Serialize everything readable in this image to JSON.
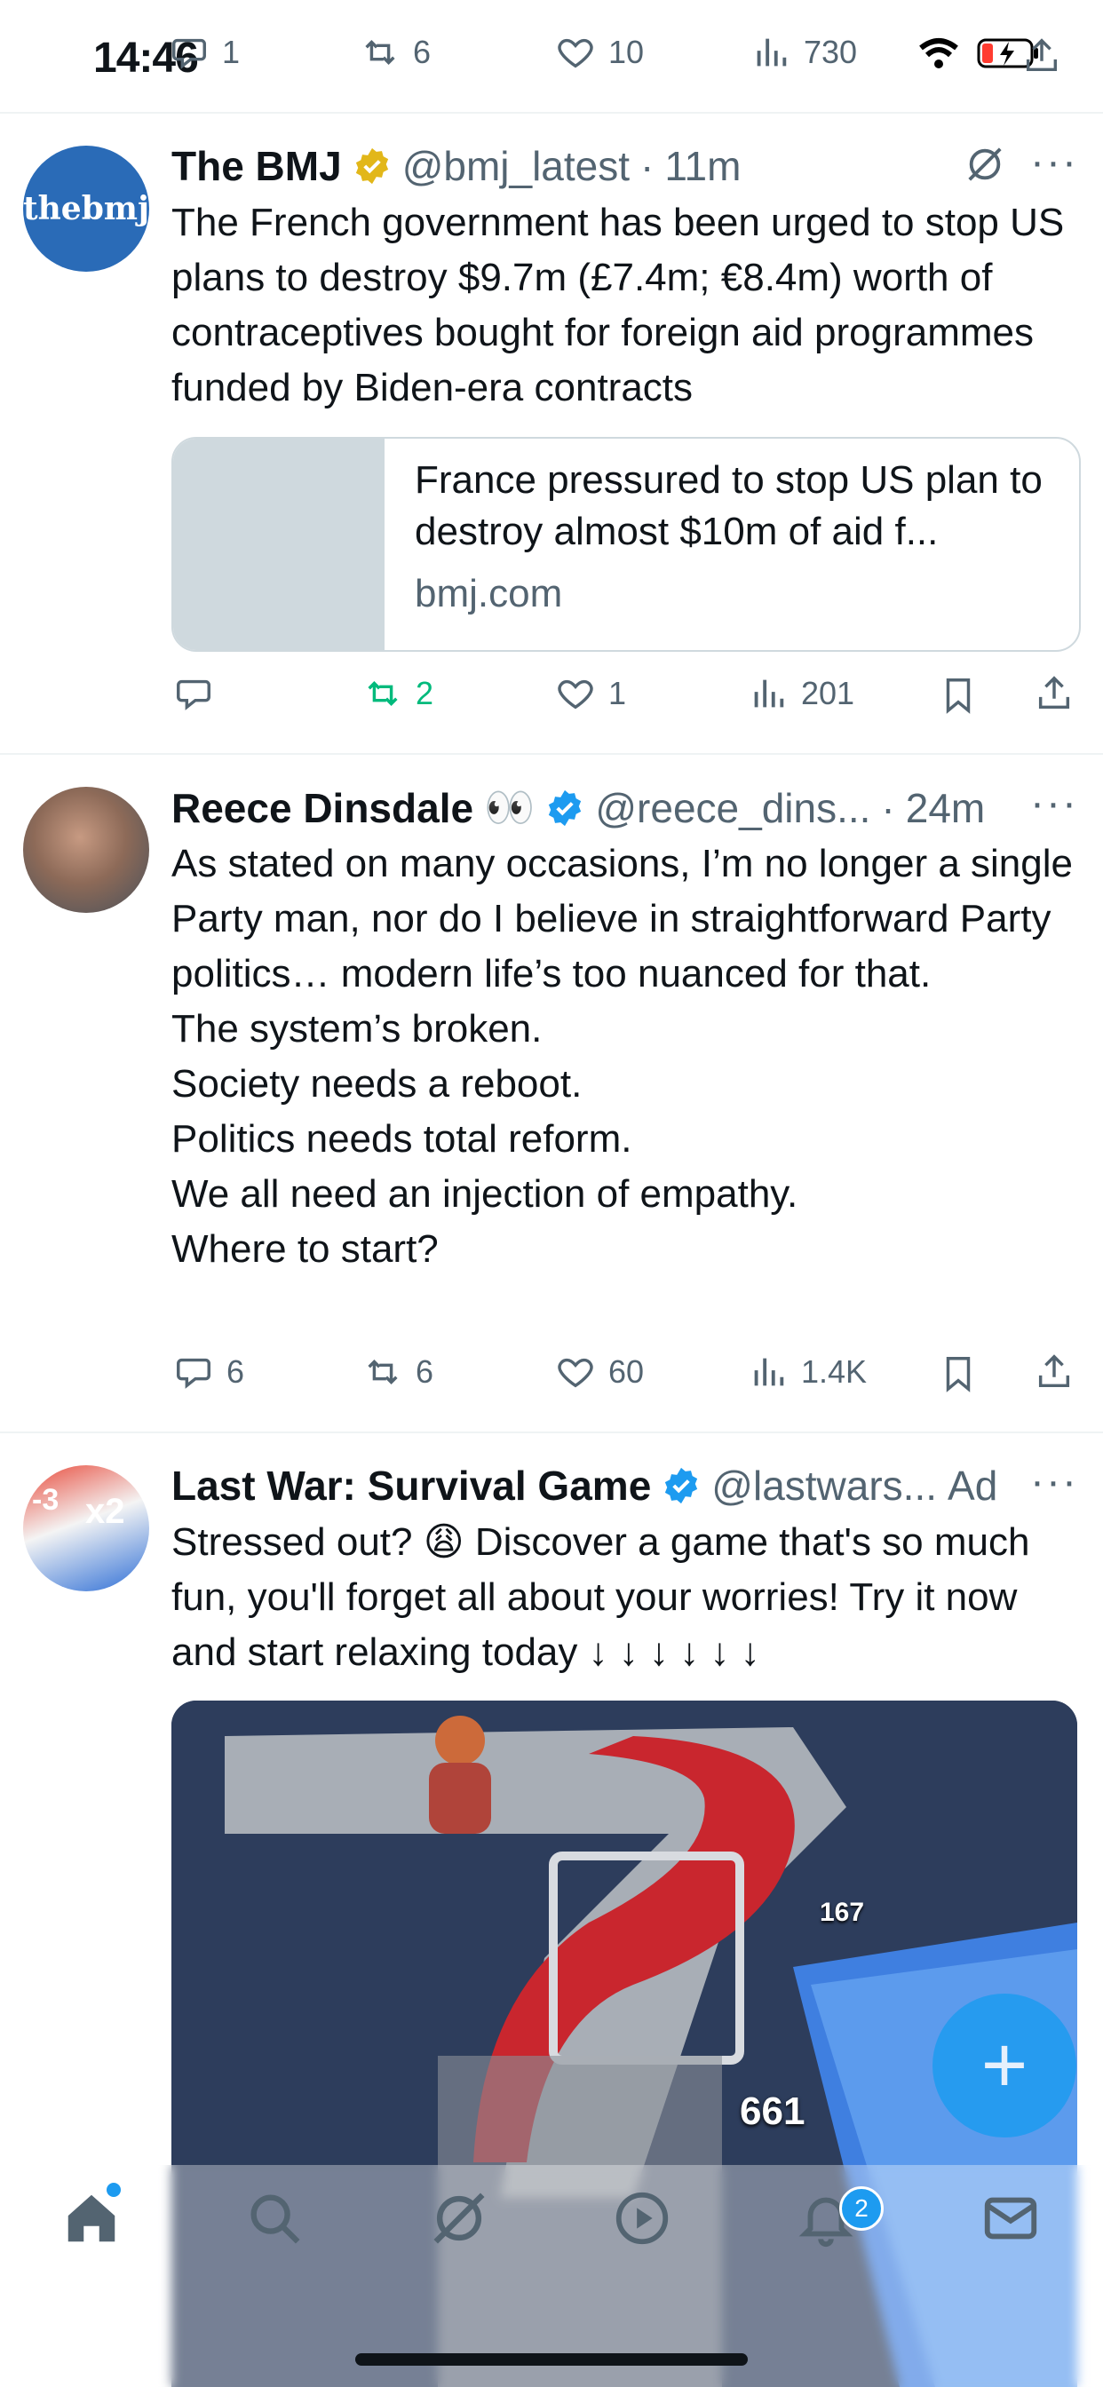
{
  "status": {
    "time": "14:46"
  },
  "top_actions": {
    "replies": "1",
    "reposts": "6",
    "likes": "10",
    "views": "730"
  },
  "bmj": {
    "avatar_text": "thebmj",
    "name": "The BMJ",
    "handle": "@bmj_latest",
    "sep": "·",
    "time": "11m",
    "text": "The French government has been urged to stop US plans to destroy $9.7m (£7.4m; €8.4m) worth of contraceptives bought for foreign aid programmes funded by Biden-era contracts",
    "card_title": "France pressured to stop US plan to destroy almost $10m of aid f...",
    "card_domain": "bmj.com",
    "replies": "",
    "reposts": "2",
    "likes": "1",
    "views": "201"
  },
  "reece": {
    "name": "Reece Dinsdale",
    "emoji": "👀",
    "handle": "@reece_dins...",
    "sep": "·",
    "time": "24m",
    "text": "As stated on many occasions, I’m no longer a single Party man, nor do I believe in straightforward Party politics… modern life’s too nuanced for that.\nThe system’s broken.\nSociety needs a reboot.\nPolitics needs total reform.\nWe all need an injection of empathy.\nWhere to start?",
    "replies": "6",
    "reposts": "6",
    "likes": "60",
    "views": "1.4K"
  },
  "ad": {
    "name": "Last War: Survival Game",
    "handle": "@lastwars...",
    "ad_label": "Ad",
    "text": "Stressed out? 😩 Discover a game that's so much fun, you'll forget all about your worries! Try it now and start relaxing today ↓ ↓ ↓ ↓ ↓ ↓",
    "media_numbers": [
      "661",
      "167"
    ],
    "avatar_labels": [
      "-3",
      "x2"
    ]
  },
  "nav": {
    "notifications_badge": "2"
  },
  "colors": {
    "accent": "#1d9bf0",
    "repost_green": "#00ba7c",
    "text": "#0f1419",
    "muted": "#536471",
    "gold": "#e2b719"
  }
}
